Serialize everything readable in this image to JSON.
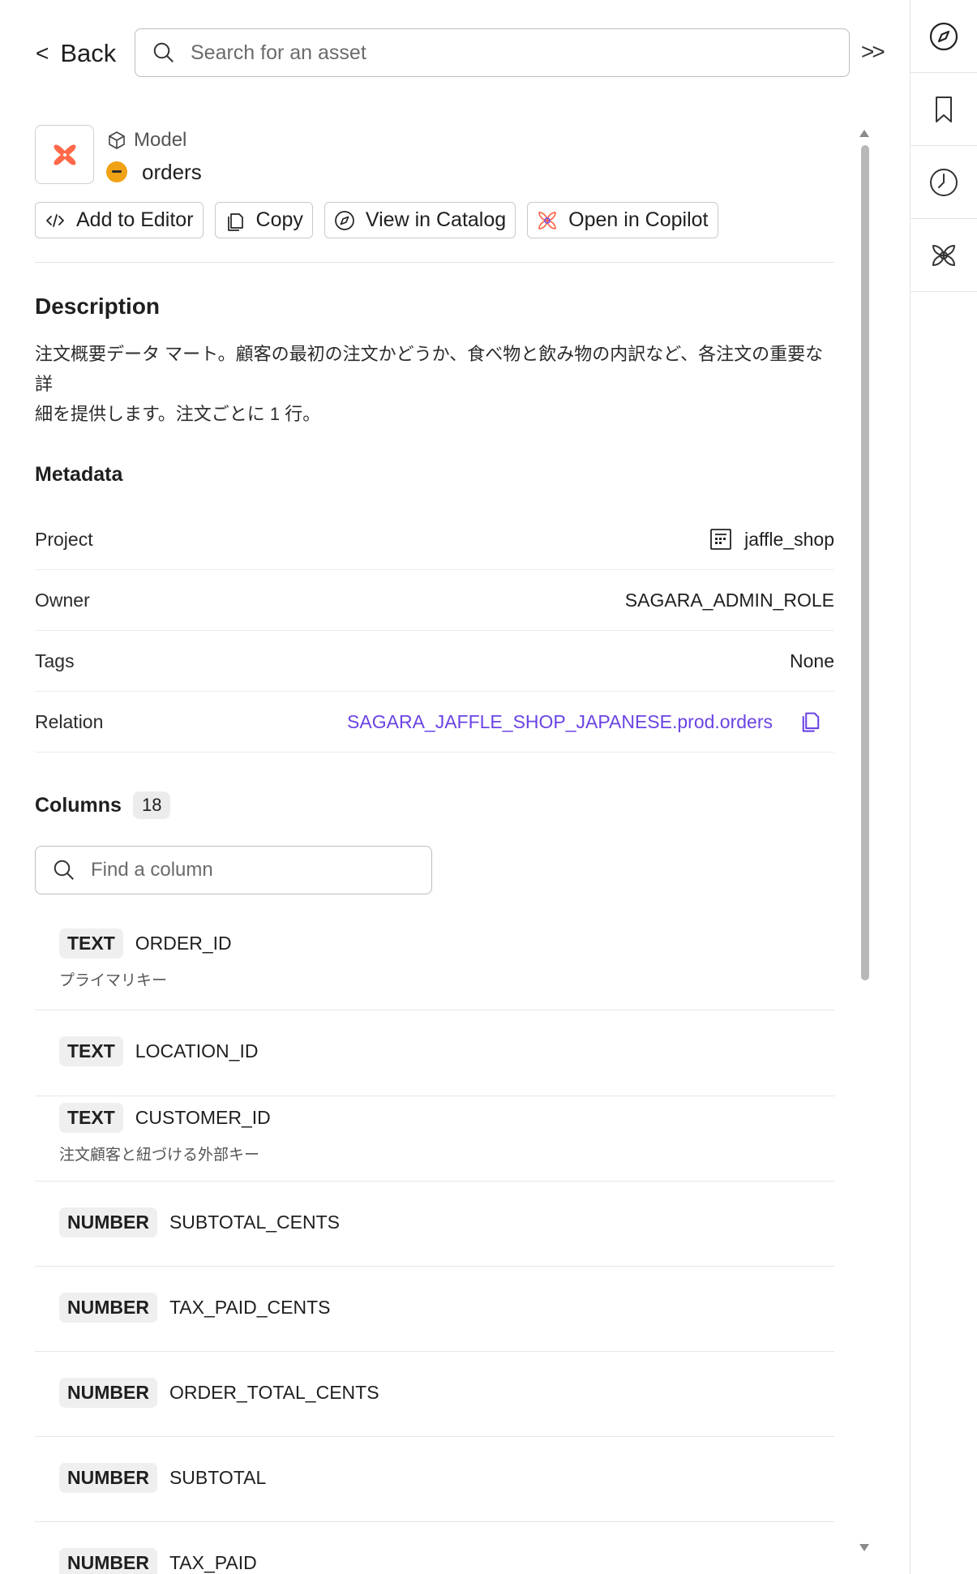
{
  "header": {
    "back_label": "Back",
    "search_placeholder": "Search for an asset",
    "expand_label": ">>"
  },
  "asset": {
    "type": "Model",
    "name": "orders"
  },
  "actions": [
    {
      "label": "Add to Editor",
      "icon": "code-icon"
    },
    {
      "label": "Copy",
      "icon": "copy-icon"
    },
    {
      "label": "View in Catalog",
      "icon": "compass-icon"
    },
    {
      "label": "Open in Copilot",
      "icon": "copilot-icon"
    }
  ],
  "description": {
    "title": "Description",
    "text_line1": "注文概要データ マート。顧客の最初の注文かどうか、食べ物と飲み物の内訳など、各注文の重要な詳",
    "text_line2": "細を提供します。注文ごとに 1 行。"
  },
  "metadata": {
    "title": "Metadata",
    "rows": [
      {
        "label": "Project",
        "value": "jaffle_shop",
        "icon": "project-icon"
      },
      {
        "label": "Owner",
        "value": "SAGARA_ADMIN_ROLE"
      },
      {
        "label": "Tags",
        "value": "None"
      },
      {
        "label": "Relation",
        "value": "SAGARA_JAFFLE_SHOP_JAPANESE.prod.orders",
        "icon": "copy-icon"
      }
    ]
  },
  "columns": {
    "title": "Columns",
    "count": "18",
    "search_placeholder": "Find a column",
    "items": [
      {
        "type": "TEXT",
        "name": "ORDER_ID",
        "description": "プライマリキー"
      },
      {
        "type": "TEXT",
        "name": "LOCATION_ID",
        "description": ""
      },
      {
        "type": "TEXT",
        "name": "CUSTOMER_ID",
        "description": "注文顧客と紐づける外部キー"
      },
      {
        "type": "NUMBER",
        "name": "SUBTOTAL_CENTS",
        "description": ""
      },
      {
        "type": "NUMBER",
        "name": "TAX_PAID_CENTS",
        "description": ""
      },
      {
        "type": "NUMBER",
        "name": "ORDER_TOTAL_CENTS",
        "description": ""
      },
      {
        "type": "NUMBER",
        "name": "SUBTOTAL",
        "description": ""
      },
      {
        "type": "NUMBER",
        "name": "TAX_PAID",
        "description": ""
      }
    ]
  },
  "rail": {
    "items": [
      "compass-icon",
      "bookmark-icon",
      "history-icon",
      "copilot-icon"
    ]
  },
  "colors": {
    "accent_link": "#6a44e4",
    "status_dot": "#f0a215",
    "brand_orange": "#ff694a"
  }
}
